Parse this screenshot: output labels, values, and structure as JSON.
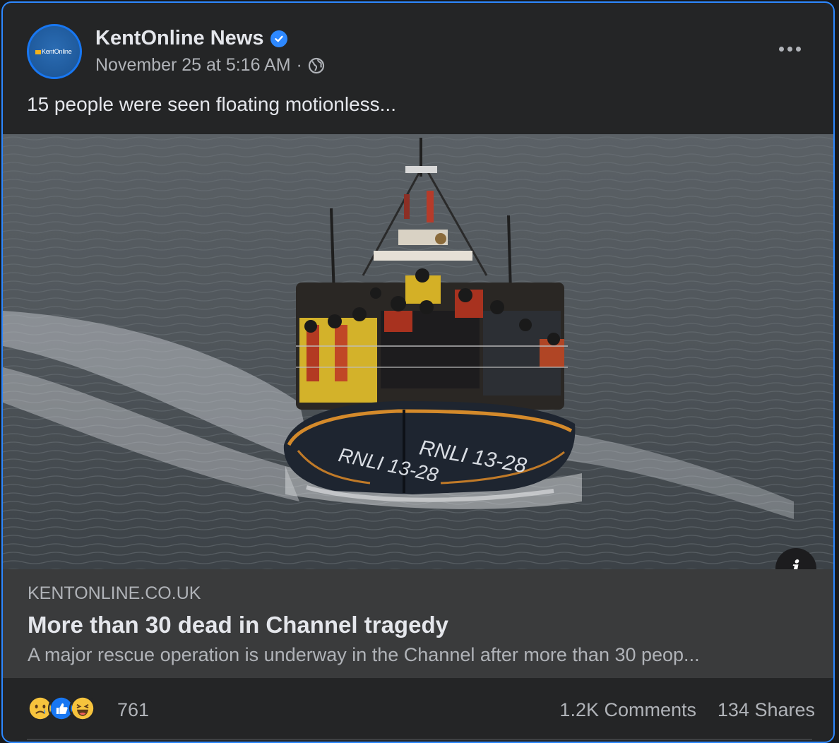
{
  "post": {
    "page_name": "KentOnline News",
    "verified": true,
    "timestamp": "November 25 at 5:16 AM",
    "separator": "·",
    "audience_icon": "globe-icon",
    "avatar_text": "KentOnline",
    "text": "15 people were seen floating motionless..."
  },
  "image": {
    "boat_markings": [
      "RNLI 13-28",
      "RNLI 13-28"
    ],
    "info_icon": "info-icon"
  },
  "link": {
    "domain": "KENTONLINE.CO.UK",
    "title": "More than 30 dead in Channel tragedy",
    "description": "A major rescue operation is underway in the Channel after more than 30 peop..."
  },
  "footer": {
    "reactions": [
      "sad-reaction-icon",
      "like-reaction-icon",
      "haha-reaction-icon"
    ],
    "reaction_count": "761",
    "comments": "1.2K Comments",
    "shares": "134 Shares"
  },
  "colors": {
    "card_bg": "#242526",
    "link_bg": "#3a3b3c",
    "primary_text": "#e4e6eb",
    "secondary_text": "#b0b3b8",
    "accent_blue": "#2d88ff"
  }
}
